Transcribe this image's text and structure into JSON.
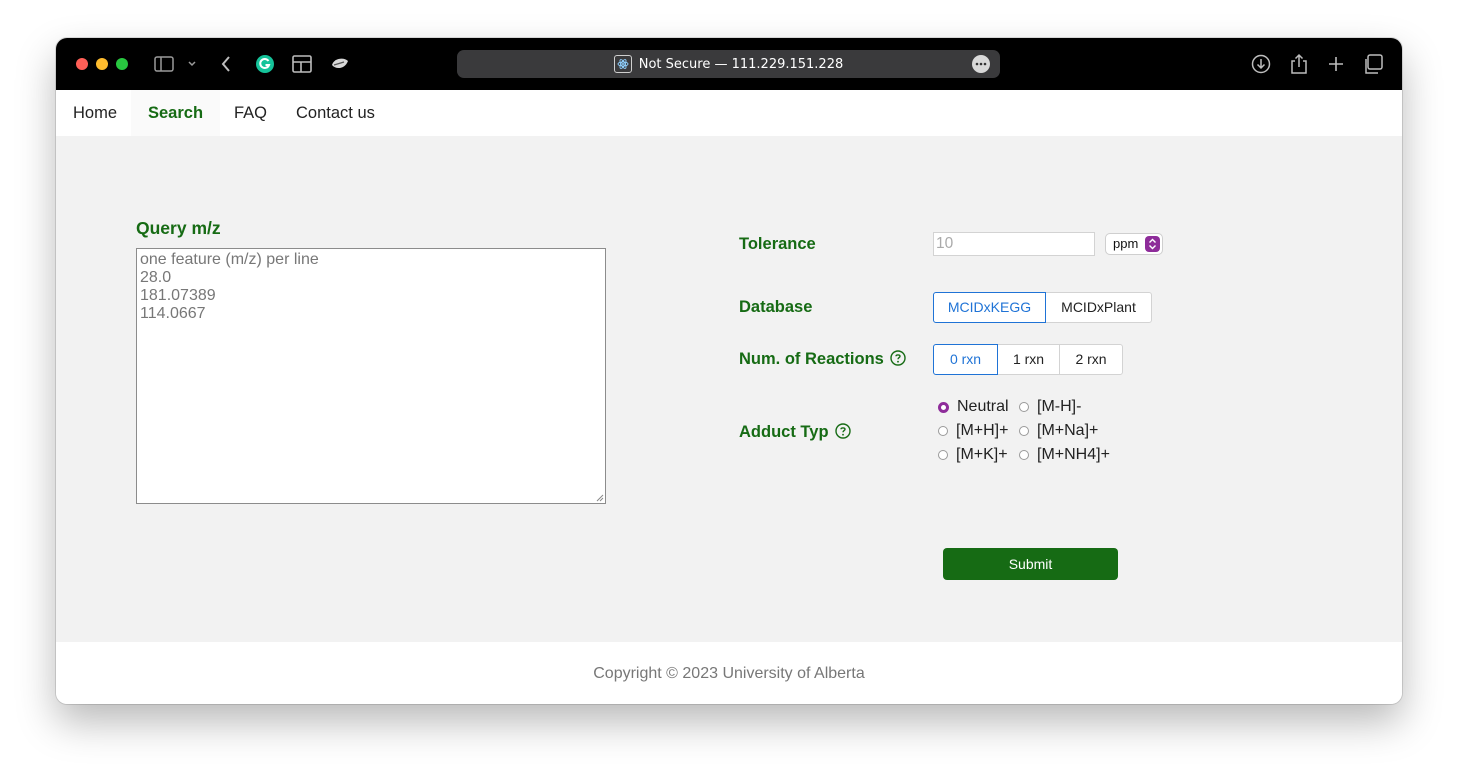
{
  "browser": {
    "address": "Not Secure — 111.229.151.228"
  },
  "nav": {
    "items": [
      "Home",
      "Search",
      "FAQ",
      "Contact us"
    ],
    "active": "Search"
  },
  "query": {
    "label": "Query m/z",
    "lines": [
      "one feature (m/z) per line",
      "28.0",
      "181.07389",
      "114.0667"
    ]
  },
  "tolerance": {
    "label": "Tolerance",
    "value": "10",
    "unit": "ppm"
  },
  "database": {
    "label": "Database",
    "options": [
      "MCIDxKEGG",
      "MCIDxPlant"
    ],
    "selected": "MCIDxKEGG"
  },
  "reactions": {
    "label": "Num. of Reactions",
    "options": [
      "0 rxn",
      "1 rxn",
      "2 rxn"
    ],
    "selected": "0 rxn"
  },
  "adduct": {
    "label": "Adduct Typ",
    "options": [
      "Neutral",
      "[M-H]-",
      "[M+H]+",
      "[M+Na]+",
      "[M+K]+",
      "[M+NH4]+"
    ],
    "selected": "Neutral"
  },
  "submit_label": "Submit",
  "footer": "Copyright © 2023 University of Alberta",
  "colors": {
    "accent_green": "#166b14",
    "selected_blue": "#1f73d6",
    "radio_purple": "#8e2c9a"
  }
}
